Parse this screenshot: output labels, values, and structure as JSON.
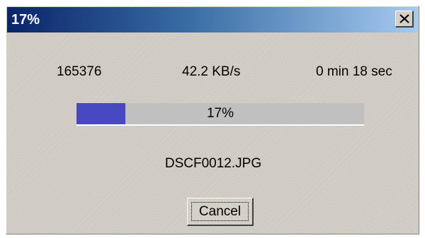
{
  "window": {
    "title": "17%",
    "close_glyph": "close-icon"
  },
  "stats": {
    "bytes": "165376",
    "speed": "42.2 KB/s",
    "time_remaining": "0 min 18 sec"
  },
  "progress": {
    "value": 0.17,
    "label": "17%",
    "fill_color": "#4848c0"
  },
  "file": {
    "name": "DSCF0012.JPG"
  },
  "actions": {
    "cancel_label": "Cancel"
  },
  "colors": {
    "titlebar_start": "#0a246a",
    "titlebar_end": "#a6caf0",
    "dialog_bg": "#d4d0c8"
  }
}
